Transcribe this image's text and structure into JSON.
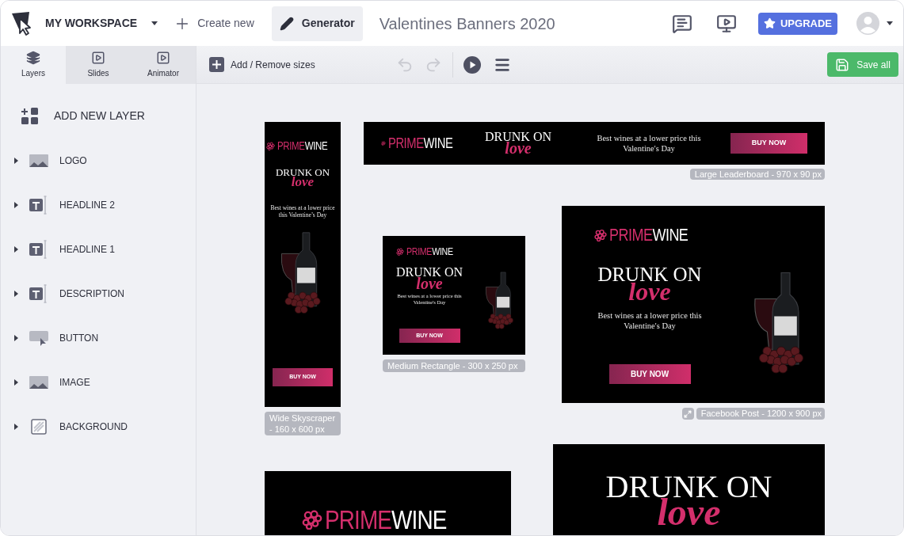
{
  "header": {
    "workspace": "MY WORKSPACE",
    "create": "Create new",
    "generator": {
      "label": "Generator",
      "selected": true
    },
    "project_title": "Valentines Banners 2020",
    "upgrade": "UPGRADE"
  },
  "panel_tabs": [
    {
      "kind": "layers",
      "label": "Layers",
      "selected": true
    },
    {
      "kind": "slides",
      "label": "Slides",
      "selected": false
    },
    {
      "kind": "animator",
      "label": "Animator",
      "selected": false
    }
  ],
  "toolbar": {
    "sizes": "Add / Remove sizes",
    "undo": {
      "disabled": true
    },
    "redo": {
      "disabled": true
    },
    "save": "Save all"
  },
  "add_layer": "ADD NEW LAYER",
  "layers": [
    {
      "kind": "image",
      "name": "LOGO",
      "expanded": false
    },
    {
      "kind": "text",
      "name": "HEADLINE 2",
      "expanded": false
    },
    {
      "kind": "text",
      "name": "HEADLINE 1",
      "expanded": false
    },
    {
      "kind": "text",
      "name": "DESCRIPTION",
      "expanded": false
    },
    {
      "kind": "button",
      "name": "BUTTON",
      "expanded": false
    },
    {
      "kind": "image",
      "name": "IMAGE",
      "expanded": false
    },
    {
      "kind": "background",
      "name": "BACKGROUND",
      "expanded": false
    }
  ],
  "banners": [
    {
      "kind": "skyscraper",
      "logo_accent": "PRIME",
      "logo_rest": "WINE",
      "headline": "DRUNK ON",
      "script": "love",
      "description": "Best wines at a lower price this Valentine’s Day",
      "cta": "BUY NOW",
      "caption": "Wide Skyscraper - 160 x 600 px"
    },
    {
      "kind": "leaderboard",
      "logo_accent": "PRIME",
      "logo_rest": "WINE",
      "headline": "DRUNK ON",
      "script": "love",
      "description": "Best wines at a lower price this Valentine's Day",
      "cta": "BUY NOW",
      "caption": "Large Leaderboard - 970 x 90 px"
    },
    {
      "kind": "rectangle",
      "logo_accent": "PRIME",
      "logo_rest": "WINE",
      "headline": "DRUNK ON",
      "script": "love",
      "description": "Best wines at a lower price this Valentine's Day",
      "cta": "BUY NOW",
      "caption": "Medium Rectangle - 300 x 250 px"
    },
    {
      "kind": "facebook",
      "logo_accent": "PRIME",
      "logo_rest": "WINE",
      "headline": "DRUNK ON",
      "script": "love",
      "description": "Best wines at a lower price this Valentine's Day",
      "cta": "BUY NOW",
      "caption": "Facebook Post - 1200 x 900 px",
      "resize_handle": true
    },
    {
      "kind": "logo_strip",
      "logo_accent": "PRIME",
      "logo_rest": "WINE"
    },
    {
      "kind": "headline_only",
      "headline": "DRUNK ON",
      "script": "love"
    }
  ]
}
